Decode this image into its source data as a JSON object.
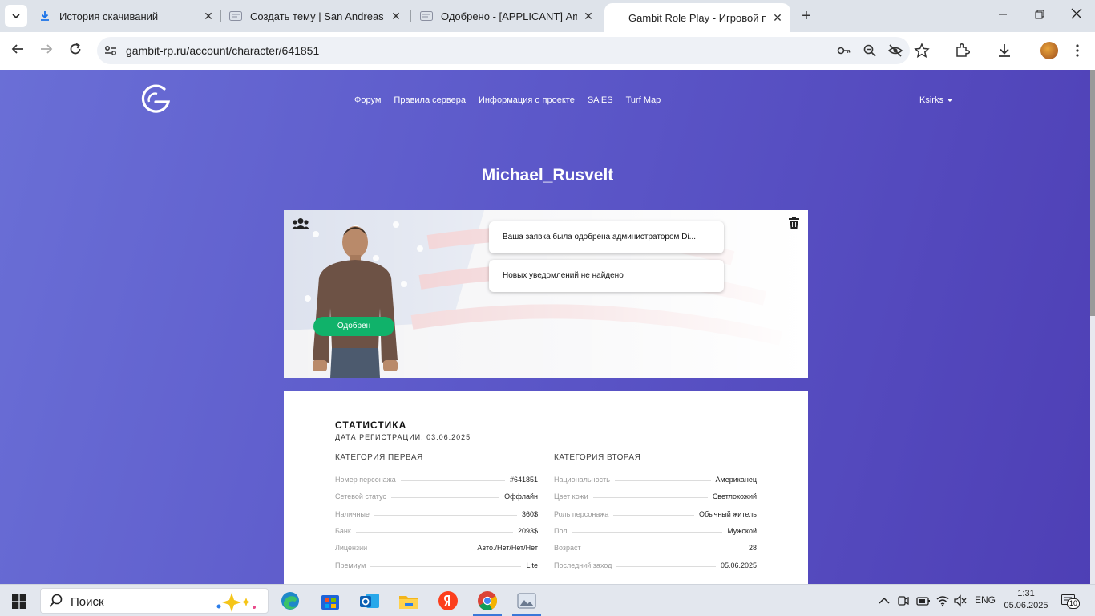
{
  "browser": {
    "tabs": [
      {
        "title": "История скачиваний",
        "icon": "download-icon"
      },
      {
        "title": "Создать тему | San Andreas Em",
        "icon": "forum-favicon-icon"
      },
      {
        "title": "Одобрено - [APPLICANT] Anto",
        "icon": "forum-favicon-icon"
      },
      {
        "title": "Gambit Role Play - Игровой пр",
        "icon": "gambit-favicon-icon"
      }
    ],
    "url": "gambit-rp.ru/account/character/641851"
  },
  "site": {
    "nav": [
      "Форум",
      "Правила сервера",
      "Информация о проекте",
      "SA ES",
      "Turf Map"
    ],
    "user": "Ksirks"
  },
  "character": {
    "name": "Michael_Rusvelt",
    "status": "Одобрен",
    "status_color": "#10b26a",
    "notifications": [
      "Ваша заявка была одобрена администратором Di...",
      "Новых уведомлений не найдено"
    ]
  },
  "stats": {
    "title": "СТАТИСТИКА",
    "registered": "ДАТА РЕГИСТРАЦИИ: 03.06.2025",
    "cat1": {
      "title": "КАТЕГОРИЯ ПЕРВАЯ",
      "rows": [
        {
          "k": "Номер персонажа",
          "v": "#641851"
        },
        {
          "k": "Сетевой статус",
          "v": "Оффлайн"
        },
        {
          "k": "Наличные",
          "v": "360$"
        },
        {
          "k": "Банк",
          "v": "2093$"
        },
        {
          "k": "Лицензии",
          "v": "Авто./Нет/Нет/Нет"
        },
        {
          "k": "Премиум",
          "v": "Lite"
        }
      ]
    },
    "cat2": {
      "title": "КАТЕГОРИЯ ВТОРАЯ",
      "rows": [
        {
          "k": "Национальность",
          "v": "Американец"
        },
        {
          "k": "Цвет кожи",
          "v": "Светлокожий"
        },
        {
          "k": "Роль персонажа",
          "v": "Обычный житель"
        },
        {
          "k": "Пол",
          "v": "Мужской"
        },
        {
          "k": "Возраст",
          "v": "28"
        },
        {
          "k": "Последний заход",
          "v": "05.06.2025"
        }
      ]
    }
  },
  "taskbar": {
    "search": "Поиск",
    "lang": "ENG",
    "time": "1:31",
    "date": "05.06.2025",
    "notif_count": "10"
  }
}
